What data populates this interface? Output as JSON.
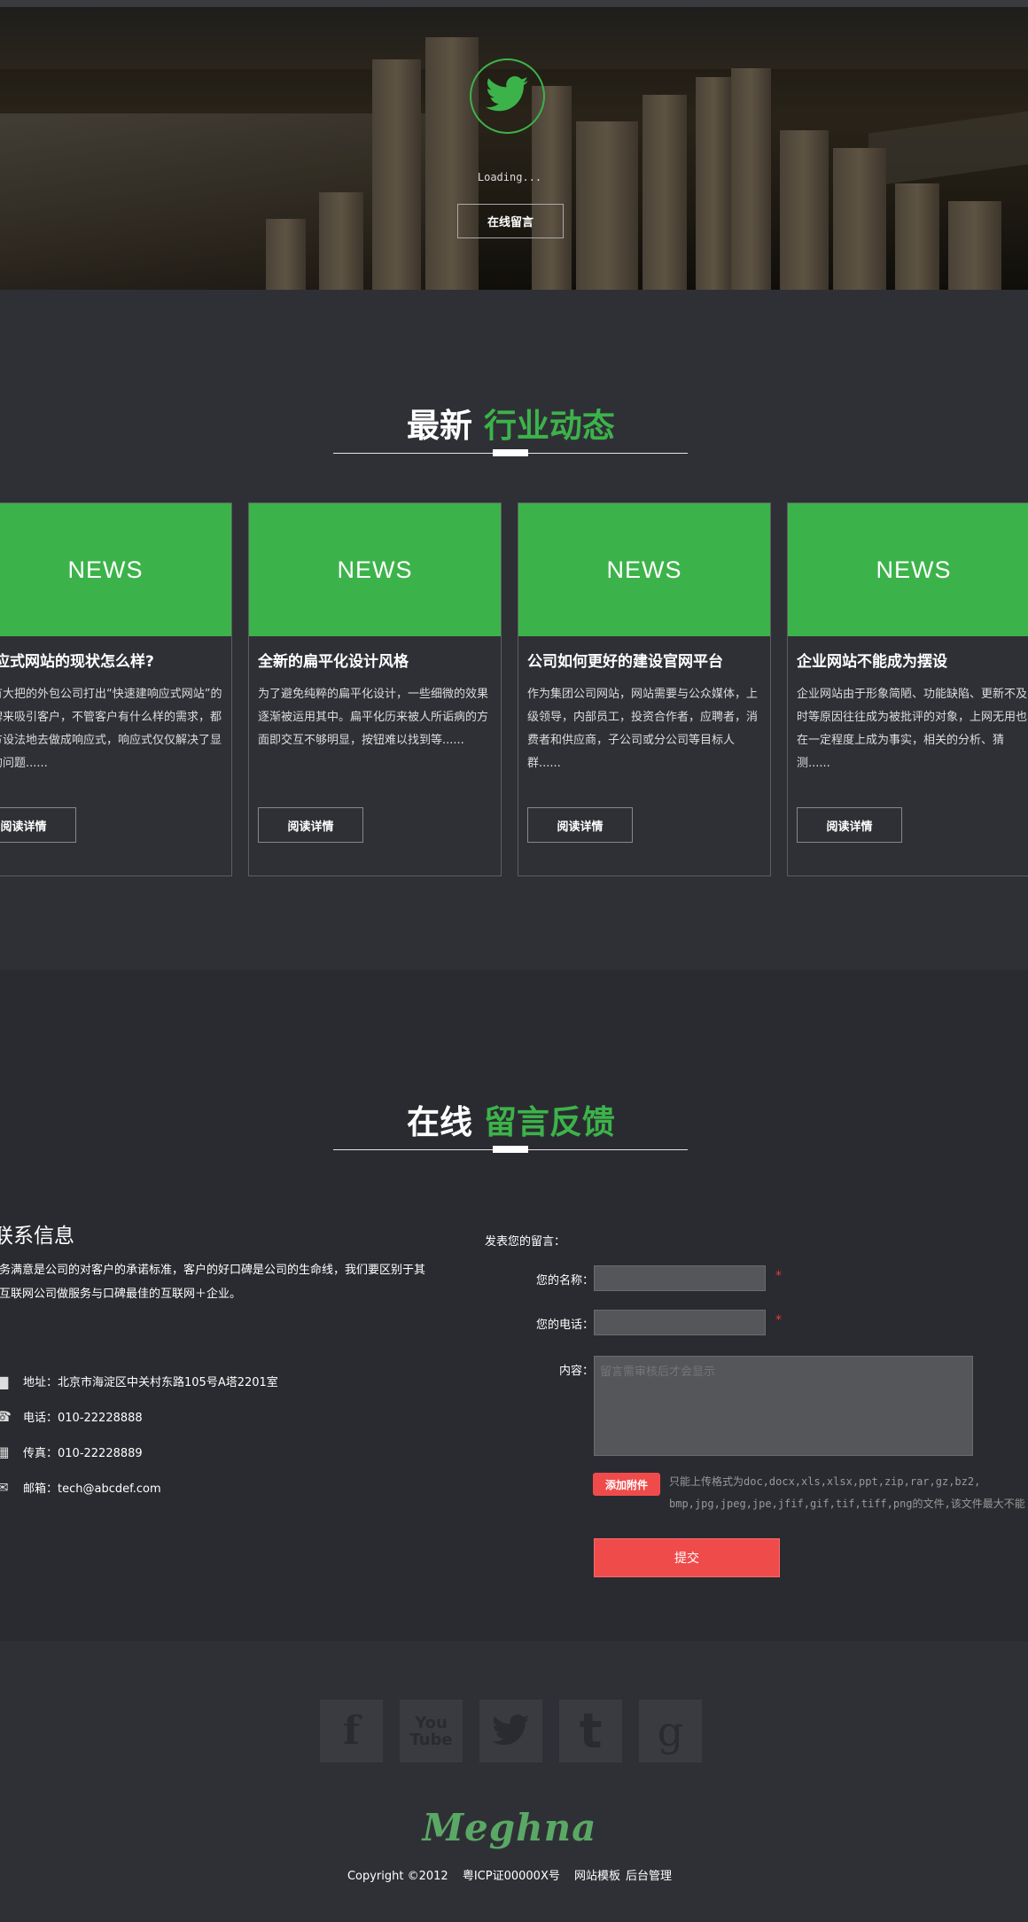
{
  "hero": {
    "loading_text": "Loading...",
    "button_label": "在线留言"
  },
  "news": {
    "title_white": "最新",
    "title_green": "行业动态",
    "cards": [
      {
        "image_text": "NEWS",
        "title": "响应式网站的现状怎么样?",
        "desc": "内有大把的外包公司打出“快速建响应式网站”的招牌来吸引客户，不管客户有什么样的需求，都想方设法地去做成响应式，响应式仅仅解决了显示的问题......",
        "button": "阅读详情"
      },
      {
        "image_text": "NEWS",
        "title": "全新的扁平化设计风格",
        "desc": "为了避免纯粹的扁平化设计，一些细微的效果逐渐被运用其中。扁平化历来被人所诟病的方面即交互不够明显，按钮难以找到等......",
        "button": "阅读详情"
      },
      {
        "image_text": "NEWS",
        "title": "公司如何更好的建设官网平台",
        "desc": "作为集团公司网站，网站需要与公众媒体，上级领导，内部员工，投资合作者，应聘者，消费者和供应商，子公司或分公司等目标人群......",
        "button": "阅读详情"
      },
      {
        "image_text": "NEWS",
        "title": "企业网站不能成为摆设",
        "desc": "企业网站由于形象简陋、功能缺陷、更新不及时等原因往往成为被批评的对象，上网无用也在一定程度上成为事实，相关的分析、猜测......",
        "button": "阅读详情"
      }
    ]
  },
  "contact": {
    "title_white": "在线",
    "title_green": "留言反馈",
    "heading": "联系信息",
    "intro": "服务满意是公司的对客户的承诺标准，客户的好口碑是公司的生命线，我们要区别于其他互联网公司做服务与口碑最佳的互联网＋企业。",
    "address": "地址：北京市海淀区中关村东路105号A塔2201室",
    "phone": "电话：010-22228888",
    "fax": "传真：010-22228889",
    "email": "邮箱：tech@abcdef.com",
    "icons": [
      "building-icon",
      "phone-icon",
      "fax-icon",
      "mail-icon"
    ]
  },
  "form": {
    "top_label": "发表您的留言：",
    "name_label": "您的名称：",
    "tel_label": "您的电话：",
    "content_label": "内容：",
    "required_mark": "*",
    "content_placeholder": "留言需审核后才会显示",
    "attach_label": "添加附件",
    "attach_note_line1": "只能上传格式为doc,docx,xls,xlsx,ppt,zip,rar,gz,bz2,",
    "attach_note_line2": "bmp,jpg,jpeg,jpe,jfif,gif,tif,tiff,png的文件,该文件最大不能",
    "submit_label": "提交"
  },
  "footer": {
    "social": [
      {
        "name": "facebook",
        "glyph": "f"
      },
      {
        "name": "youtube",
        "glyph": "You Tube"
      },
      {
        "name": "twitter",
        "glyph": ""
      },
      {
        "name": "tumblr",
        "glyph": "t"
      },
      {
        "name": "google",
        "glyph": "g"
      }
    ],
    "logo": "Meghna",
    "copyright": "Copyright ©2012",
    "icp": "粤ICP证00000X号",
    "link_template": "网站模板",
    "link_admin": "后台管理"
  },
  "colors": {
    "accent_green": "#3cb34a",
    "accent_red": "#f04b4b",
    "background": "#2f3036"
  }
}
